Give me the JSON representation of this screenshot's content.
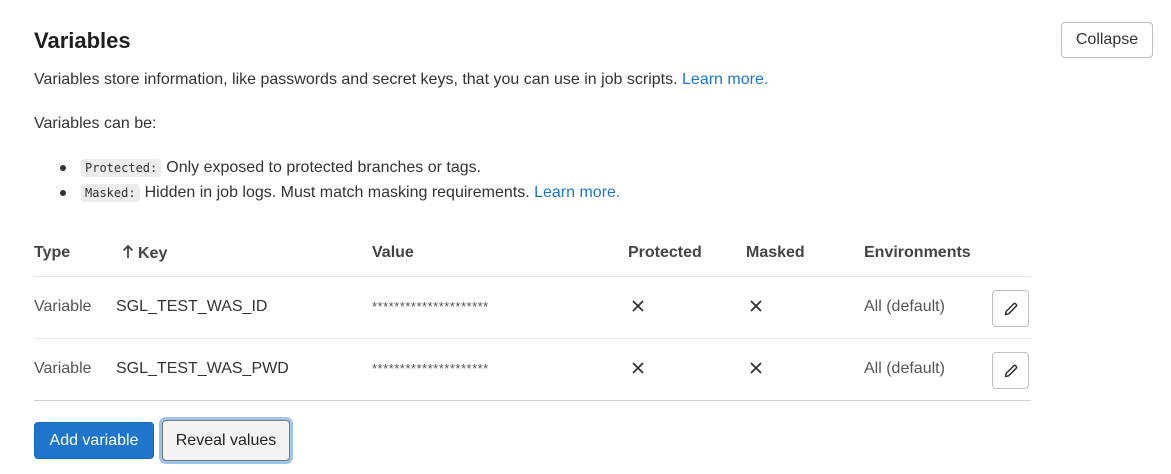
{
  "header": {
    "title": "Variables",
    "collapse_label": "Collapse"
  },
  "description": {
    "text": "Variables store information, like passwords and secret keys, that you can use in job scripts.",
    "link": "Learn more."
  },
  "can_be": "Variables can be:",
  "bullets": [
    {
      "code": "Protected:",
      "text": "Only exposed to protected branches or tags.",
      "link": ""
    },
    {
      "code": "Masked:",
      "text": "Hidden in job logs. Must match masking requirements.",
      "link": "Learn more."
    }
  ],
  "table": {
    "headers": {
      "type": "Type",
      "key": "Key",
      "value": "Value",
      "protected": "Protected",
      "masked": "Masked",
      "environments": "Environments"
    },
    "sort_icon": "arrow-up-icon",
    "rows": [
      {
        "type": "Variable",
        "key": "SGL_TEST_WAS_ID",
        "value": "*********************",
        "protected": false,
        "masked": false,
        "environments": "All (default)"
      },
      {
        "type": "Variable",
        "key": "SGL_TEST_WAS_PWD",
        "value": "*********************",
        "protected": false,
        "masked": false,
        "environments": "All (default)"
      }
    ]
  },
  "actions": {
    "add_label": "Add variable",
    "reveal_label": "Reveal values"
  },
  "colors": {
    "primary": "#1f75cb",
    "link": "#1f75cb",
    "focus_ring": "#9cc3ea"
  }
}
